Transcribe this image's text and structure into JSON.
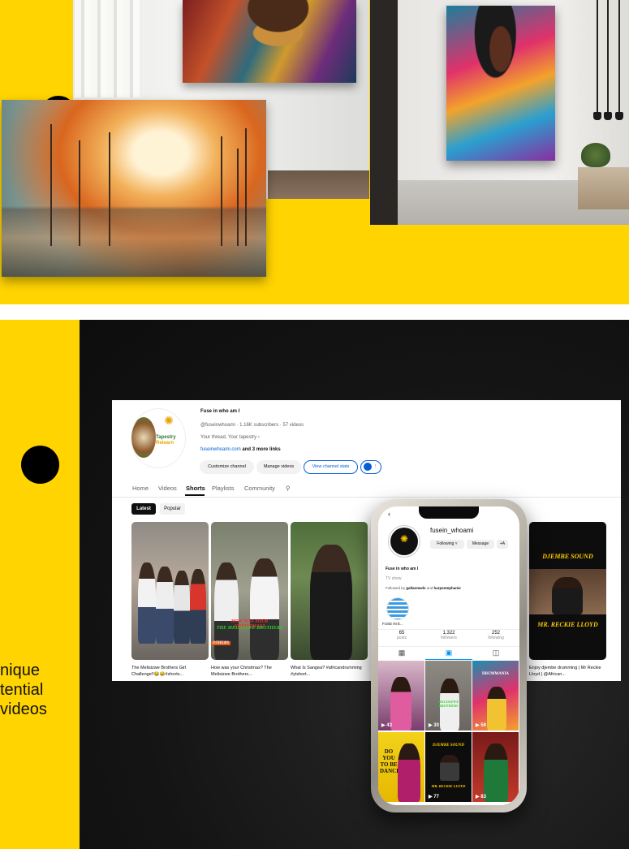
{
  "side_text": {
    "line1": "nique",
    "line2": "tential",
    "line3": "videos"
  },
  "youtube": {
    "channel_name": "Fuse in who am I",
    "meta": "@fuseinwhoami · 1.16K subscribers · 57 videos",
    "description": "Your thread, Your tapestry",
    "link": "fuseinwhoami.com",
    "link_more": "and 3 more links",
    "avatar_brand": "Tapestry",
    "avatar_brand_sub": "Relearn",
    "buttons": {
      "customize": "Customize channel",
      "manage": "Manage videos",
      "stats": "View channel stats"
    },
    "tabs": [
      "Home",
      "Videos",
      "Shorts",
      "Playlists",
      "Community"
    ],
    "active_tab": "Shorts",
    "chips": {
      "latest": "Latest",
      "popular": "Popular"
    },
    "shorts": [
      {
        "caption": "The Melisizwe Brothers Girl Challenge!!😂😂#shorts..."
      },
      {
        "caption": "How was your Christmas? The Melisizwe Brothers...",
        "overlay1": "HOW WAS YOUR CHRISTMAS?",
        "overlay2": "THE MELISIZWE BROTHERS",
        "overlay3": "OTHERS"
      },
      {
        "caption": "What Is Sangea? #africandrumming #ytshort..."
      },
      {
        "caption": "Enjoy djembe drumming | Mr Reckie Lloyd | @African...",
        "overlay1": "DJEMBE SOUND",
        "overlay2": "MR. RECKIE LLOYD"
      }
    ]
  },
  "instagram": {
    "username": "fusein_whoami",
    "following_btn": "Following ˅",
    "message_btn": "Message",
    "add_btn": "+A",
    "bio_name": "Fuse in who am I",
    "category": "TV show",
    "followed_by_prefix": "Followed by ",
    "followed_by_users": "gallanmwls",
    "followed_by_and": " and ",
    "followed_by_users2": "harpestephanie",
    "highlight_label": "FUSE IN E...",
    "stats": [
      {
        "value": "65",
        "label": "posts"
      },
      {
        "value": "1,322",
        "label": "followers"
      },
      {
        "value": "252",
        "label": "following"
      }
    ],
    "grid_counts": [
      "43",
      "30",
      "59",
      "77",
      "83"
    ],
    "grid_texts": {
      "cell_b": "MELISIZWE BROTHERS",
      "cell_c": "DRUMMANIA",
      "cell_d": "DO YOU TO BE DANCE",
      "cell_e": "DJEMBE SOUND",
      "cell_e2": "MR. RECKIE LLOYD"
    }
  }
}
